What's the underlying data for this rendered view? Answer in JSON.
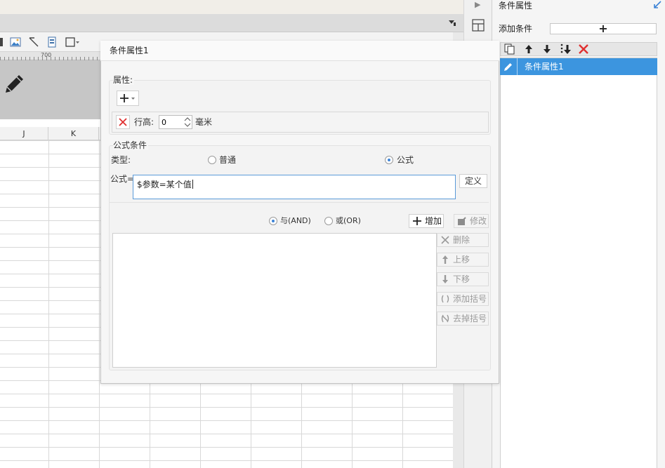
{
  "ruler": {
    "label": "700"
  },
  "columns": [
    "J",
    "K"
  ],
  "right_panel": {
    "title": "条件属性",
    "add_condition_label": "添加条件",
    "add_button_label": "+",
    "items": [
      {
        "label": "条件属性1",
        "selected": true
      }
    ]
  },
  "dialog": {
    "title": "条件属性1",
    "properties": {
      "label": "属性:",
      "row_height_label": "行高:",
      "row_height_value": "0",
      "row_height_unit": "毫米"
    },
    "formula_condition": {
      "label": "公式条件",
      "type_label": "类型:",
      "type_options": [
        "普通",
        "公式"
      ],
      "selected_type": "公式",
      "formula_label": "公式=",
      "formula_value": "$参数=某个值",
      "define_button": "定义",
      "logic_options": [
        "与(AND)",
        "或(OR)"
      ],
      "selected_logic": "与(AND)",
      "add_button": "增加",
      "edit_button": "修改",
      "delete_button": "删除",
      "move_up_button": "上移",
      "move_down_button": "下移",
      "add_parens_button": "添加括号",
      "remove_parens_button": "去掉括号"
    }
  },
  "colors": {
    "accent": "#3c95df",
    "delete_red": "#e03030"
  }
}
